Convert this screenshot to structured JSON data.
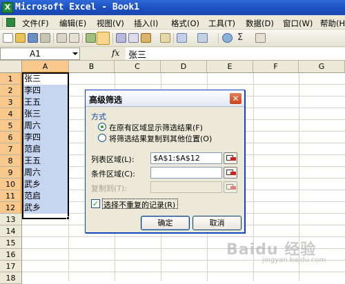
{
  "window": {
    "title": "Microsoft Excel - Book1",
    "logo_glyph": "X"
  },
  "menu": {
    "items": [
      "文件(F)",
      "编辑(E)",
      "视图(V)",
      "插入(I)",
      "格式(O)",
      "工具(T)",
      "数据(D)",
      "窗口(W)",
      "帮助(H)"
    ]
  },
  "toolbar": {
    "sigma_label": "Σ",
    "icons": [
      "new-icon",
      "open-icon",
      "save-icon",
      "permission-icon",
      "print-icon",
      "print-preview-icon",
      "spelling-icon",
      "research-icon",
      "cut-icon",
      "copy-icon",
      "paste-icon",
      "format-painter-icon",
      "undo-icon",
      "redo-icon",
      "hyperlink-icon",
      "autosum-icon",
      "sort-ascending-icon"
    ]
  },
  "formula_bar": {
    "name_box": "A1",
    "fx_label": "fx",
    "value": "张三"
  },
  "grid": {
    "columns": [
      "A",
      "B",
      "C",
      "D",
      "E",
      "F",
      "G"
    ],
    "rows": [
      "1",
      "2",
      "3",
      "4",
      "5",
      "6",
      "7",
      "8",
      "9",
      "10",
      "11",
      "12",
      "13",
      "14",
      "15",
      "16",
      "17",
      "18"
    ],
    "column_a_values": [
      "张三",
      "李四",
      "王五",
      "张三",
      "周六",
      "李四",
      "范启",
      "王五",
      "周六",
      "武乡",
      "范启",
      "武乡"
    ]
  },
  "dialog": {
    "title": "高级筛选",
    "method_label": "方式",
    "radio_filter_in_place": "在原有区域显示筛选结果(F)",
    "radio_copy_to": "将筛选结果复制到其他位置(O)",
    "list_range_label": "列表区域(L):",
    "list_range_value": "$A$1:$A$12",
    "criteria_range_label": "条件区域(C):",
    "criteria_range_value": "",
    "copy_to_label": "复制到(T):",
    "copy_to_value": "",
    "unique_records_label": "选择不重复的记录(R)",
    "unique_records_checked": true,
    "checkmark": "✓",
    "ok_label": "确定",
    "cancel_label": "取消",
    "close_glyph": "✕"
  },
  "watermark": {
    "text": "Baidu 经验",
    "sub": "jingyan.baidu.com"
  },
  "colors": {
    "title_bar": "#1c4fc0",
    "selection_fill": "#c6d5f0",
    "header_selected": "#f8c88c",
    "dialog_bg": "#ece9d8"
  }
}
